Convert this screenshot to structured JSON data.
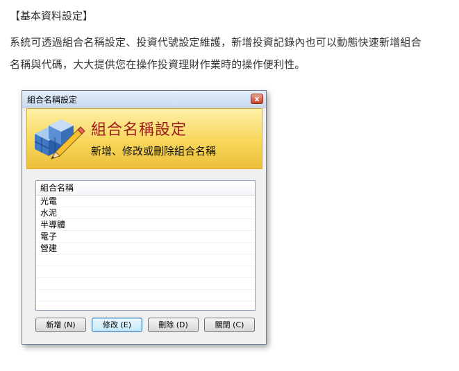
{
  "article": {
    "heading": "【基本資料設定】",
    "paragraph_line1": "系統可透過組合名稱設定、投資代號設定維護，新增投資記錄內也可以動態快速新增組合",
    "paragraph_line2": "名稱與代碼，大大提供您在操作投資理財作業時的操作便利性。"
  },
  "window": {
    "title": "組合名稱設定",
    "close_label": "x",
    "banner": {
      "title": "組合名稱設定",
      "subtitle": "新增、修改或刪除組合名稱",
      "icon": "pencil-cubes-icon"
    },
    "list": {
      "header": "組合名稱",
      "items": [
        "光電",
        "水泥",
        "半導體",
        "電子",
        "營建"
      ]
    },
    "buttons": {
      "add": "新增 (N)",
      "edit": "修改 (E)",
      "delete": "刪除 (D)",
      "close": "關閉 (C)"
    }
  }
}
